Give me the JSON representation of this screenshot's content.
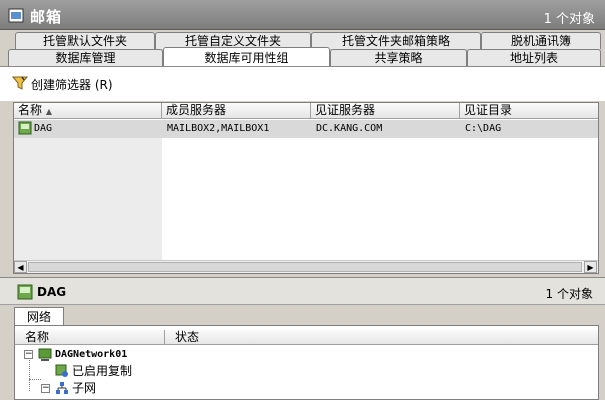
{
  "window": {
    "title": "邮箱",
    "count": "1 个对象"
  },
  "tabs_row1": [
    "托管默认文件夹",
    "托管自定义文件夹",
    "托管文件夹邮箱策略",
    "脱机通讯簿"
  ],
  "tabs_row2": [
    "数据库管理",
    "数据库可用性组",
    "共享策略",
    "地址列表"
  ],
  "toolbar": {
    "create_filter": "创建筛选器 (R)"
  },
  "table": {
    "columns": [
      "名称",
      "成员服务器",
      "见证服务器",
      "见证目录"
    ],
    "rows": [
      {
        "name": "DAG",
        "members": "MAILBOX2,MAILBOX1",
        "witness_server": "DC.KANG.COM",
        "witness_dir": "C:\\DAG"
      }
    ]
  },
  "detail": {
    "name": "DAG",
    "count": "1 个对象",
    "tab": "网络",
    "columns": [
      "名称",
      "状态"
    ],
    "tree": {
      "network": "DAGNetwork01",
      "replication": "已启用复制",
      "subnet": "子网"
    }
  },
  "colors": {
    "titlebar": "#8a8a8a",
    "tab_active": "#ffffff",
    "selection": "#d9d9d9"
  }
}
